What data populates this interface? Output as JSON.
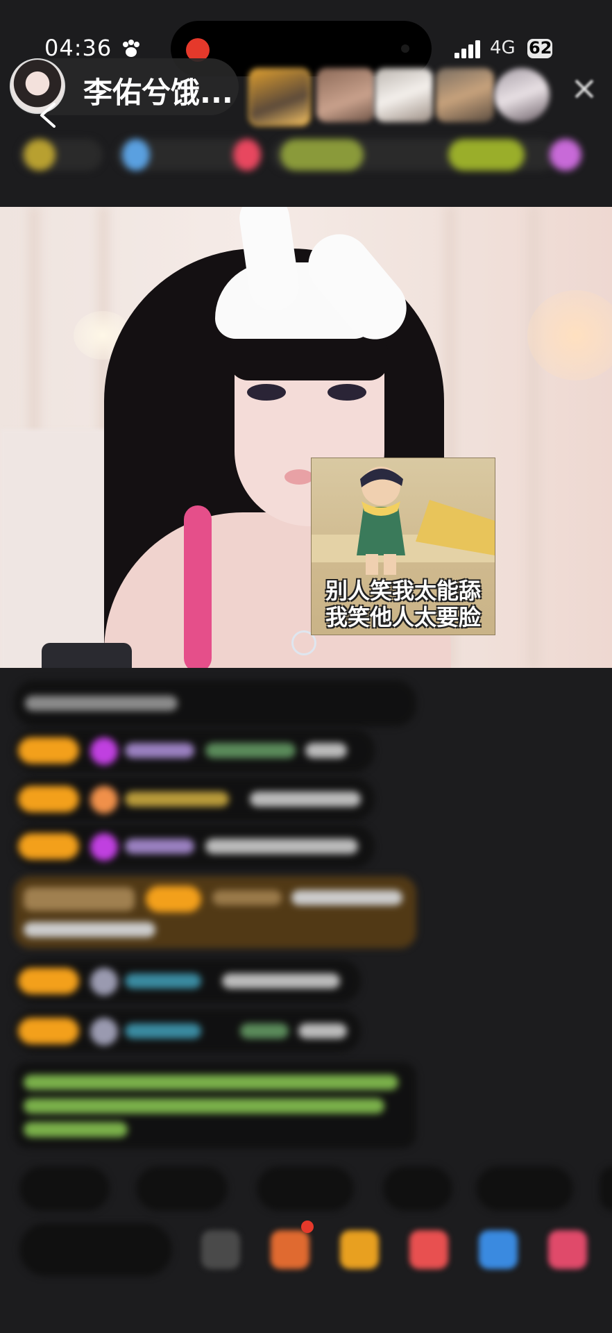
{
  "status_bar": {
    "time": "04:36",
    "network": "4G",
    "battery": "62",
    "icons": [
      "paw-icon",
      "signal-icon",
      "battery-icon"
    ]
  },
  "header": {
    "host_name": "李佑兮饿...",
    "icons": [
      "back-chevron-icon",
      "close-icon"
    ]
  },
  "meme": {
    "caption_line1": "别人笑我太能舔",
    "caption_line2": "我笑他人太要脸"
  },
  "colors": {
    "background": "#1c1c1e",
    "rec_dot": "#e5392b",
    "level_tag": "#f3a01b",
    "chat_text_green": "#9ad66a"
  }
}
